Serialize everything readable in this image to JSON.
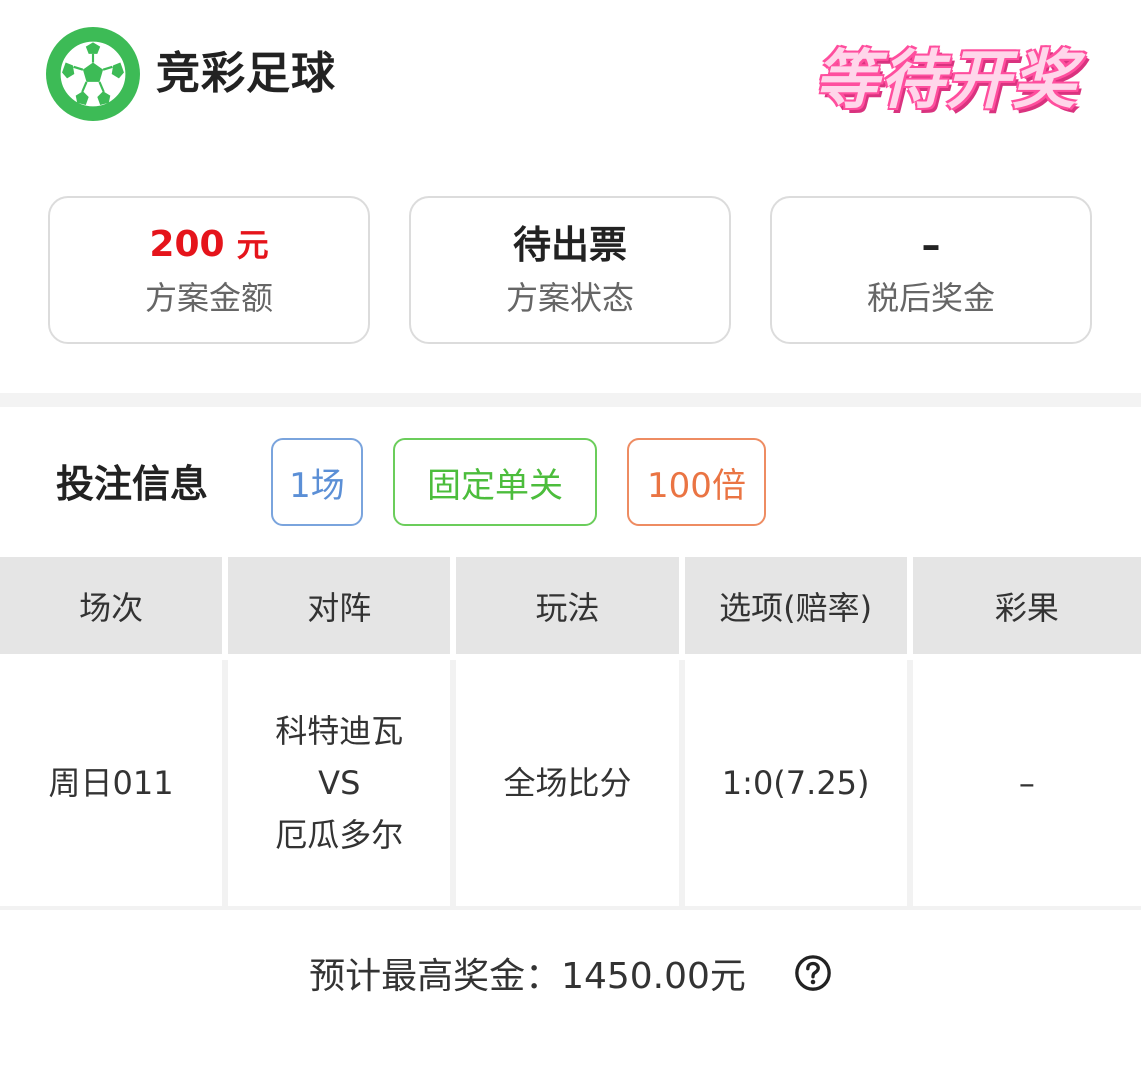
{
  "header": {
    "app_title": "竞彩足球",
    "status_stamp": "等待开奖",
    "logo_icon": "soccer-ball-icon",
    "logo_color": "#3dbb56"
  },
  "summary": {
    "amount_value": "200",
    "amount_unit": "元",
    "amount_label": "方案金额",
    "status_value": "待出票",
    "status_label": "方案状态",
    "prize_value": "–",
    "prize_label": "税后奖金",
    "amount_color": "#e5141b"
  },
  "bet_info": {
    "title": "投注信息",
    "tags": [
      "1场",
      "固定单关",
      "100倍"
    ],
    "tag_colors": [
      "#5b8fd6",
      "#4cbd3c",
      "#ea7443"
    ]
  },
  "table": {
    "headers": [
      "场次",
      "对阵",
      "玩法",
      "选项(赔率)",
      "彩果"
    ],
    "rows": [
      {
        "match_no": "周日011",
        "home": "科特迪瓦",
        "vs": "VS",
        "away": "厄瓜多尔",
        "play": "全场比分",
        "option": "1:0(7.25)",
        "result": "–"
      }
    ]
  },
  "footer": {
    "max_prize": "预计最高奖金：1450.00元",
    "help_icon": "question-circle-icon"
  }
}
